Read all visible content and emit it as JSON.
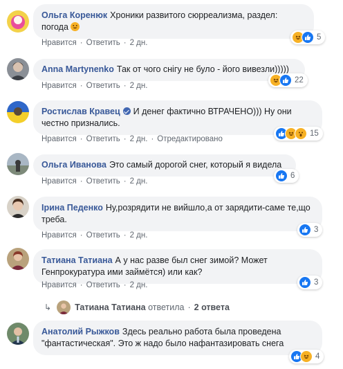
{
  "actions": {
    "like": "Нравится",
    "reply": "Ответить",
    "sep": "·",
    "edited": "Отредактировано"
  },
  "comments": [
    {
      "author": "Ольга Коренюк",
      "text": "Хроники развитого сюрреализма, раздел: погода",
      "time": "2 дн.",
      "reactions": [
        "haha",
        "like"
      ],
      "count": "5",
      "emoji": "grinning-face-icon"
    },
    {
      "author": "Anna Martynenko",
      "text": "Так от чого снігу не було - його вивезли)))))",
      "time": "2 дн.",
      "reactions": [
        "haha",
        "like"
      ],
      "count": "22"
    },
    {
      "author": "Ростислав Кравец",
      "text": "И денег фактично ВТРАЧЕНО))) Ну они честно признались.",
      "time": "2 дн.",
      "edited": true,
      "reactions": [
        "like",
        "haha",
        "wow"
      ],
      "count": "15"
    },
    {
      "author": "Ольга Иванова",
      "text": "Это самый дорогой снег, который я видела",
      "time": "2 дн.",
      "reactions": [
        "like"
      ],
      "count": "6"
    },
    {
      "author": "Ірина Педенко",
      "text": "Ну,розрядити не вийшло,а от зарядити-саме те,що треба.",
      "time": "2 дн.",
      "reactions": [
        "like"
      ],
      "count": "3"
    },
    {
      "author": "Татиана Татиана",
      "text": "А у нас разве был снег зимой? Может Генпрокуратура ими займётся) или как?",
      "time": "2 дн.",
      "reactions": [
        "like"
      ],
      "count": "3"
    },
    {
      "author": "Анатолий Рыжков",
      "text": "Здесь реально работа была проведена \"фантастическая\". Это ж надо было нафантазировать снега",
      "time": "2 дн.",
      "reactions": [
        "like",
        "haha"
      ],
      "count": "4"
    }
  ],
  "replies_thread": {
    "author": "Татиана Татиана",
    "verb": "ответила",
    "count": "2 ответа"
  },
  "colors": {
    "author": "#385898",
    "bubble": "#f2f3f5",
    "like": "#1877f2",
    "haha": "#f7b125",
    "meta": "#606770"
  }
}
